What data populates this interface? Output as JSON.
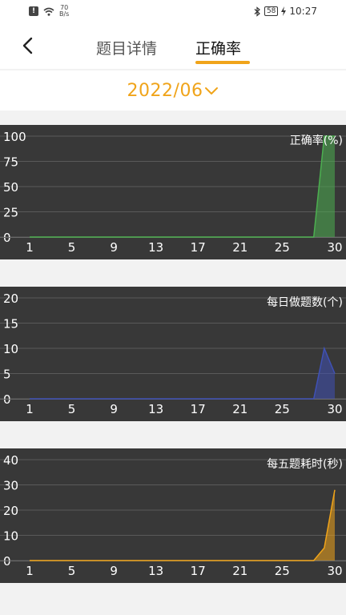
{
  "status_bar": {
    "speed_value": "70",
    "speed_unit": "B/s",
    "battery": "58",
    "time": "10:27",
    "icons": [
      "notification-icon",
      "wifi-icon",
      "bluetooth-icon",
      "charging-icon"
    ]
  },
  "nav": {
    "back_icon": "chevron-left-icon",
    "tabs": [
      {
        "label": "题目详情",
        "active": false
      },
      {
        "label": "正确率",
        "active": true
      }
    ],
    "accent_color": "#f0a41a"
  },
  "month_selector": {
    "value": "2022/06",
    "icon": "chevron-down-icon"
  },
  "chart_data": [
    {
      "type": "area",
      "title": "正确率(%)",
      "x_ticks": [
        "1",
        "5",
        "9",
        "13",
        "17",
        "21",
        "25",
        "30"
      ],
      "y_ticks": [
        "100",
        "75",
        "50",
        "25",
        "0"
      ],
      "xlim": [
        1,
        30
      ],
      "ylim": [
        0,
        100
      ],
      "grid": true,
      "color": "#4caf50",
      "x": [
        1,
        2,
        3,
        4,
        5,
        6,
        7,
        8,
        9,
        10,
        11,
        12,
        13,
        14,
        15,
        16,
        17,
        18,
        19,
        20,
        21,
        22,
        23,
        24,
        25,
        26,
        27,
        28,
        29,
        30
      ],
      "y": [
        0,
        0,
        0,
        0,
        0,
        0,
        0,
        0,
        0,
        0,
        0,
        0,
        0,
        0,
        0,
        0,
        0,
        0,
        0,
        0,
        0,
        0,
        0,
        0,
        0,
        0,
        0,
        0,
        100,
        100
      ]
    },
    {
      "type": "area",
      "title": "每日做题数(个)",
      "x_ticks": [
        "1",
        "5",
        "9",
        "13",
        "17",
        "21",
        "25",
        "30"
      ],
      "y_ticks": [
        "20",
        "15",
        "10",
        "5",
        "0"
      ],
      "xlim": [
        1,
        30
      ],
      "ylim": [
        0,
        20
      ],
      "grid": true,
      "color": "#3f51b5",
      "x": [
        1,
        2,
        3,
        4,
        5,
        6,
        7,
        8,
        9,
        10,
        11,
        12,
        13,
        14,
        15,
        16,
        17,
        18,
        19,
        20,
        21,
        22,
        23,
        24,
        25,
        26,
        27,
        28,
        29,
        30
      ],
      "y": [
        0,
        0,
        0,
        0,
        0,
        0,
        0,
        0,
        0,
        0,
        0,
        0,
        0,
        0,
        0,
        0,
        0,
        0,
        0,
        0,
        0,
        0,
        0,
        0,
        0,
        0,
        0,
        0,
        10,
        5
      ]
    },
    {
      "type": "area",
      "title": "每五题耗时(秒)",
      "x_ticks": [
        "1",
        "5",
        "9",
        "13",
        "17",
        "21",
        "25",
        "30"
      ],
      "y_ticks": [
        "40",
        "30",
        "20",
        "10",
        "0"
      ],
      "xlim": [
        1,
        30
      ],
      "ylim": [
        0,
        40
      ],
      "grid": true,
      "color": "#f0a41a",
      "x": [
        1,
        2,
        3,
        4,
        5,
        6,
        7,
        8,
        9,
        10,
        11,
        12,
        13,
        14,
        15,
        16,
        17,
        18,
        19,
        20,
        21,
        22,
        23,
        24,
        25,
        26,
        27,
        28,
        29,
        30
      ],
      "y": [
        0,
        0,
        0,
        0,
        0,
        0,
        0,
        0,
        0,
        0,
        0,
        0,
        0,
        0,
        0,
        0,
        0,
        0,
        0,
        0,
        0,
        0,
        0,
        0,
        0,
        0,
        0,
        0,
        5,
        28
      ]
    }
  ]
}
